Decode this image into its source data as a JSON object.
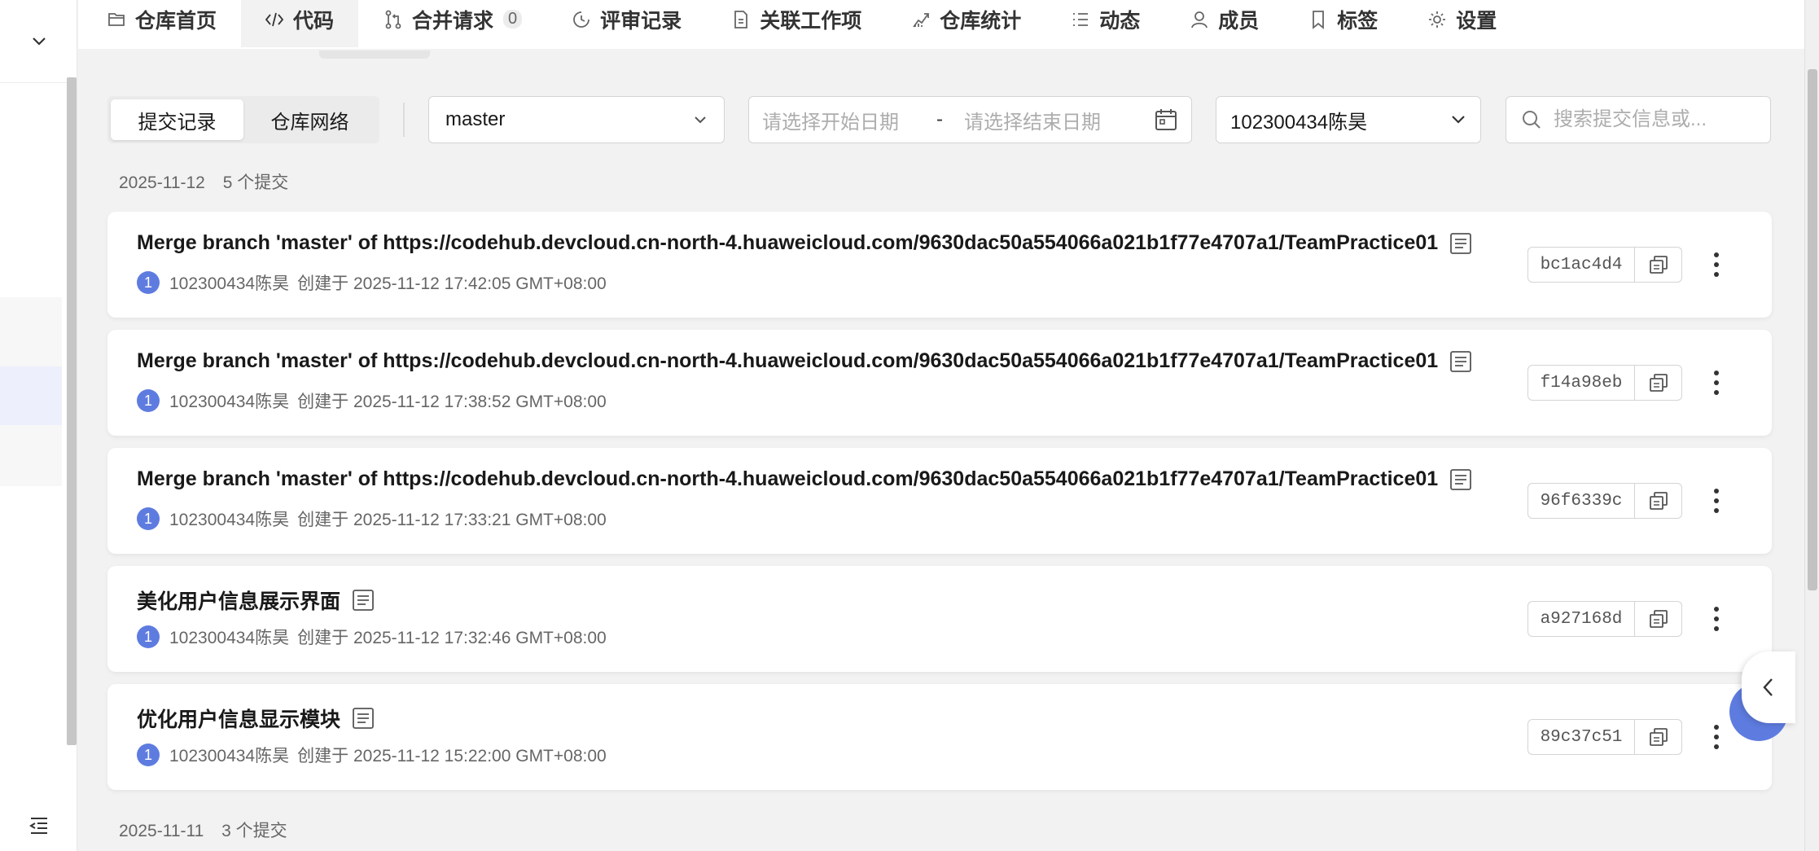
{
  "nav": {
    "tabs": [
      {
        "label": "仓库首页",
        "icon": "folder-icon"
      },
      {
        "label": "代码",
        "icon": "code-icon",
        "active": true
      },
      {
        "label": "合并请求",
        "icon": "merge-icon",
        "badge": "0"
      },
      {
        "label": "评审记录",
        "icon": "review-icon"
      },
      {
        "label": "关联工作项",
        "icon": "document-icon"
      },
      {
        "label": "仓库统计",
        "icon": "chart-icon"
      },
      {
        "label": "动态",
        "icon": "list-icon"
      },
      {
        "label": "成员",
        "icon": "user-icon"
      },
      {
        "label": "标签",
        "icon": "bookmark-icon"
      },
      {
        "label": "设置",
        "icon": "gear-icon"
      }
    ]
  },
  "filters": {
    "view_toggle": [
      "提交记录",
      "仓库网络"
    ],
    "branch": "master",
    "start_date_placeholder": "请选择开始日期",
    "date_separator": "-",
    "end_date_placeholder": "请选择结束日期",
    "author": "102300434陈昊",
    "search_placeholder": "搜索提交信息或..."
  },
  "groups": [
    {
      "date": "2025-11-12",
      "count": "5 个提交"
    },
    {
      "date": "2025-11-11",
      "count": "3 个提交"
    }
  ],
  "commits": [
    {
      "message": "Merge branch 'master' of https://codehub.devcloud.cn-north-4.huaweicloud.com/9630dac50a554066a021b1f77e4707a1/TeamPractice01",
      "avatar": "1",
      "author": "102300434陈昊",
      "created": "创建于 2025-11-12 17:42:05 GMT+08:00",
      "hash": "bc1ac4d4"
    },
    {
      "message": "Merge branch 'master' of https://codehub.devcloud.cn-north-4.huaweicloud.com/9630dac50a554066a021b1f77e4707a1/TeamPractice01",
      "avatar": "1",
      "author": "102300434陈昊",
      "created": "创建于 2025-11-12 17:38:52 GMT+08:00",
      "hash": "f14a98eb"
    },
    {
      "message": "Merge branch 'master' of https://codehub.devcloud.cn-north-4.huaweicloud.com/9630dac50a554066a021b1f77e4707a1/TeamPractice01",
      "avatar": "1",
      "author": "102300434陈昊",
      "created": "创建于 2025-11-12 17:33:21 GMT+08:00",
      "hash": "96f6339c"
    },
    {
      "message": "美化用户信息展示界面",
      "avatar": "1",
      "author": "102300434陈昊",
      "created": "创建于 2025-11-12 17:32:46 GMT+08:00",
      "hash": "a927168d"
    },
    {
      "message": "优化用户信息显示模块",
      "avatar": "1",
      "author": "102300434陈昊",
      "created": "创建于 2025-11-12 15:22:00 GMT+08:00",
      "hash": "89c37c51"
    }
  ],
  "colors": {
    "accent": "#5e7ce0",
    "background": "#f2f2f2",
    "card": "#ffffff"
  }
}
